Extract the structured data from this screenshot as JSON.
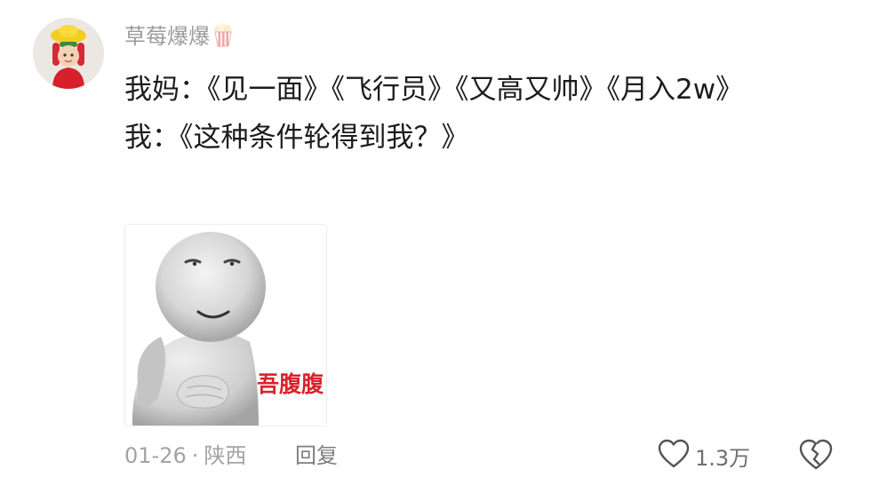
{
  "comment": {
    "username": "草莓爆爆",
    "username_emoji_icon": "popcorn-icon",
    "lines": [
      "我妈：《见一面》《飞行员》《又高又帅》《月入2w》",
      "我：《这种条件轮得到我？》"
    ],
    "sticker": {
      "caption": "吾腹腹",
      "caption_color": "#d8242b"
    },
    "date": "01-26",
    "separator": "·",
    "location": "陕西",
    "reply_label": "回复",
    "likes": "1.3万",
    "like_icon": "heart-outline-icon",
    "dislike_icon": "broken-heart-icon"
  },
  "colors": {
    "text": "#1c1c1c",
    "muted": "#a3a3a3",
    "username": "#9c9c9c"
  }
}
